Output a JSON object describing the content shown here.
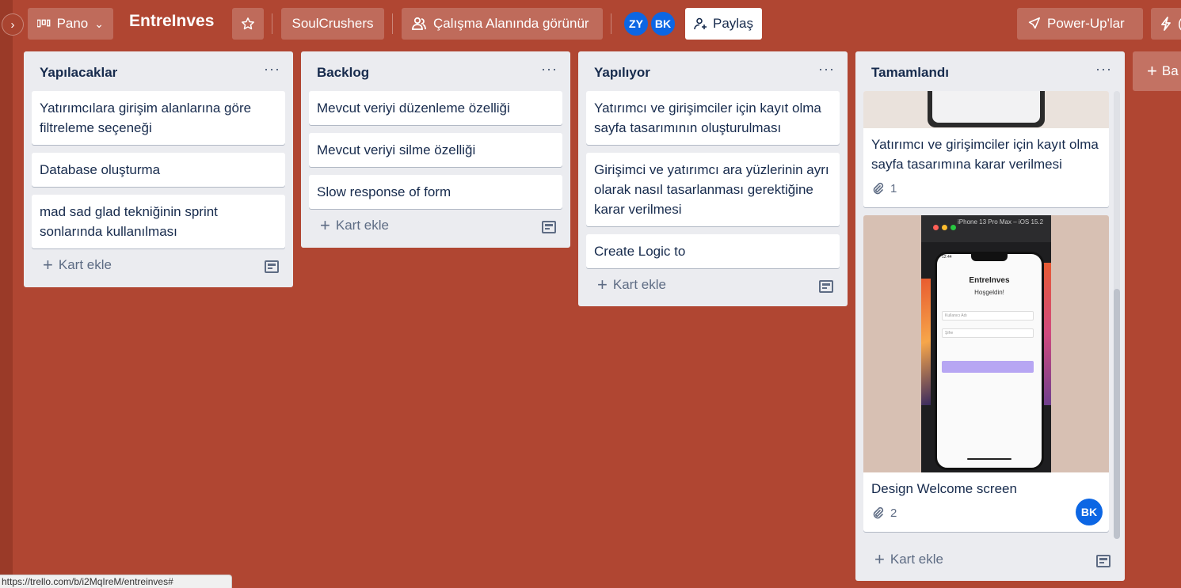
{
  "header": {
    "view_label": "Pano",
    "board_title": "EntreInves",
    "workspace": "SoulCrushers",
    "visibility": "Çalışma Alanında görünür",
    "members": [
      "ZY",
      "BK"
    ],
    "share_label": "Paylaş",
    "powerups_label": "Power-Up'lar",
    "automation_partial": "("
  },
  "lists": [
    {
      "title": "Yapılacaklar",
      "cards": [
        "Yatırımcılara girişim alanlarına göre filtreleme seçeneği",
        "Database oluşturma",
        "mad sad glad tekniğinin sprint sonlarında kullanılması"
      ],
      "add_label": "Kart ekle"
    },
    {
      "title": "Backlog",
      "cards": [
        "Mevcut veriyi düzenleme özelliği",
        "Mevcut veriyi silme özelliği",
        "Slow response of form"
      ],
      "add_label": "Kart ekle"
    },
    {
      "title": "Yapılıyor",
      "cards": [
        "Yatırımcı ve girişimciler için kayıt olma sayfa tasarımının oluşturulması",
        "Girişimci ve yatırımcı ara yüzlerinin ayrı olarak nasıl tasarlanması gerektiğine karar verilmesi",
        "Create Logic to"
      ],
      "add_label": "Kart ekle"
    },
    {
      "title": "Tamamlandı",
      "cards": [
        {
          "title": "Yatırımcı ve girişimciler için kayıt olma sayfa tasarımına karar verilmesi",
          "attachments": "1"
        },
        {
          "title": "Design Welcome screen",
          "attachments": "2",
          "member": "BK",
          "cover": {
            "device": "iPhone 13 Pro Max – iOS 15.2",
            "time": "12:44",
            "app_title": "EntreInves",
            "greeting": "Hoşgeldin!",
            "field1": "Kullanıcı Adı",
            "field2": "Şifre"
          }
        }
      ],
      "add_label": "Kart ekle"
    }
  ],
  "add_list_label": "Ba",
  "status_url": "https://trello.com/b/i2MqIreM/entreinves#",
  "colors": {
    "board_bg": "#b04632",
    "list_bg": "#ebecf0",
    "member_blue": "#0c66e4"
  }
}
